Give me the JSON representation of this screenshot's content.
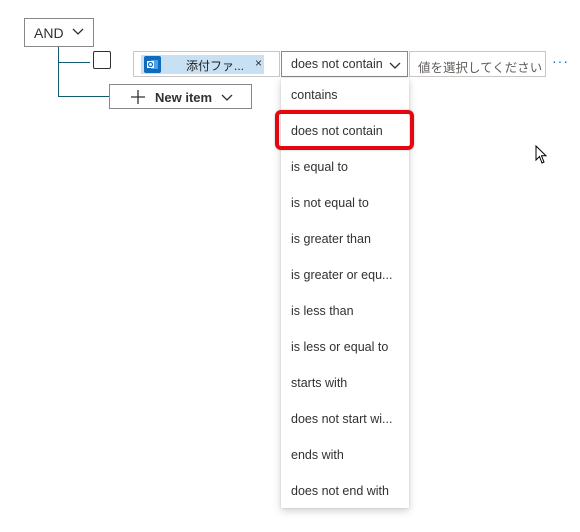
{
  "group": {
    "operator_label": "AND"
  },
  "condition": {
    "token_label": "添付ファ...",
    "token_close": "×",
    "operator_selected": "does not contain",
    "value_placeholder": "値を選択してください",
    "more_label": "···"
  },
  "new_item": {
    "label": "New item"
  },
  "dropdown": {
    "options": [
      "contains",
      "does not contain",
      "is equal to",
      "is not equal to",
      "is greater than",
      "is greater or equ...",
      "is less than",
      "is less or equal to",
      "starts with",
      "does not start wi...",
      "ends with",
      "does not end with"
    ],
    "highlighted_option": "does not contain"
  },
  "colors": {
    "accent": "#0f6cbd",
    "tree_line": "#0f5b72",
    "token_bg": "#c7e0f4",
    "highlight_border": "#e3070f"
  },
  "icons": {
    "token": "outlook-icon",
    "chevron": "chevron-down-icon",
    "plus": "plus-icon",
    "cursor": "mouse-pointer-icon"
  }
}
